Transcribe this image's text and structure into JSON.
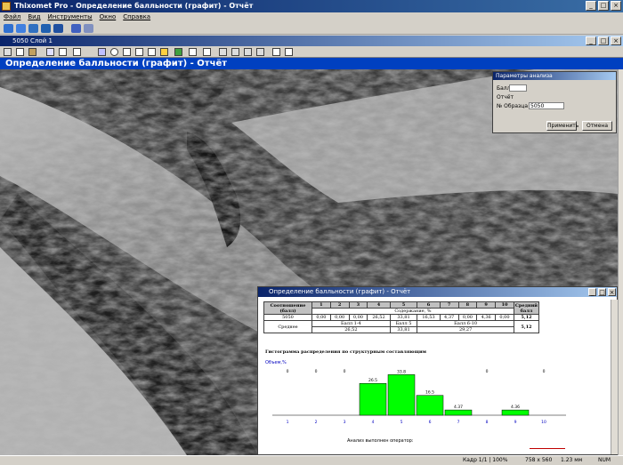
{
  "app": {
    "title": "Thixomet Pro - Определение балльности (графит) - Отчёт"
  },
  "menu": [
    "Файл",
    "Вид",
    "Инструменты",
    "Окно",
    "Справка"
  ],
  "subwindow": {
    "title": "5050 Слой 1"
  },
  "report": {
    "header": "Определение балльности (графит) - Отчёт"
  },
  "params_dialog": {
    "title": "Параметры анализа",
    "ball_label": "Балл",
    "otchet_label": "Отчёт",
    "sample_label": "№ Образца",
    "sample_value": "5050",
    "ok": "Применить",
    "cancel": "Отмена"
  },
  "report_dialog": {
    "title": "Определение балльности (графит) - Отчёт",
    "table": {
      "col_header": "Соотношение (балл)",
      "cols": [
        "1",
        "2",
        "3",
        "4",
        "5",
        "6",
        "7",
        "8",
        "9",
        "10"
      ],
      "last_col": "Средний балл",
      "subheader": "Содержание, %",
      "row1_label": "5050",
      "row1_values": [
        "0,00",
        "0,00",
        "0,00",
        "26,52",
        "33,81",
        "16,53",
        "4,37",
        "0,00",
        "4,36",
        "0,00"
      ],
      "row1_avg": "5,12",
      "row2_label": "Среднее",
      "row2_groups": [
        "Балл 1-4",
        "Балл 5",
        "Балл 6-10"
      ],
      "row2_values": [
        "26,52",
        "33,81",
        "29,27"
      ],
      "row2_avg": "5,12"
    },
    "chart_title": "Гистограмма распределения по структурным составляющим",
    "chart_axis_label": "Объем,%",
    "chart_bottom_label": "Анализ выполнен оператор:"
  },
  "chart_data": {
    "type": "bar",
    "categories": [
      "1",
      "2",
      "3",
      "4",
      "5",
      "6",
      "7",
      "8",
      "9",
      "10"
    ],
    "values": [
      0,
      0,
      0,
      26.5,
      33.8,
      16.5,
      4.37,
      0,
      4.36,
      0
    ],
    "labels": [
      "0",
      "0",
      "0",
      "26.5",
      "33.8",
      "16.5",
      "4.37",
      "0",
      "4.36",
      "0"
    ],
    "bar_color": "#00ff00"
  },
  "status": {
    "s1": "Кадр 1/1 | 100%",
    "s2": "758 x 560",
    "s3": "1.23 мм",
    "s4": "NUM"
  }
}
